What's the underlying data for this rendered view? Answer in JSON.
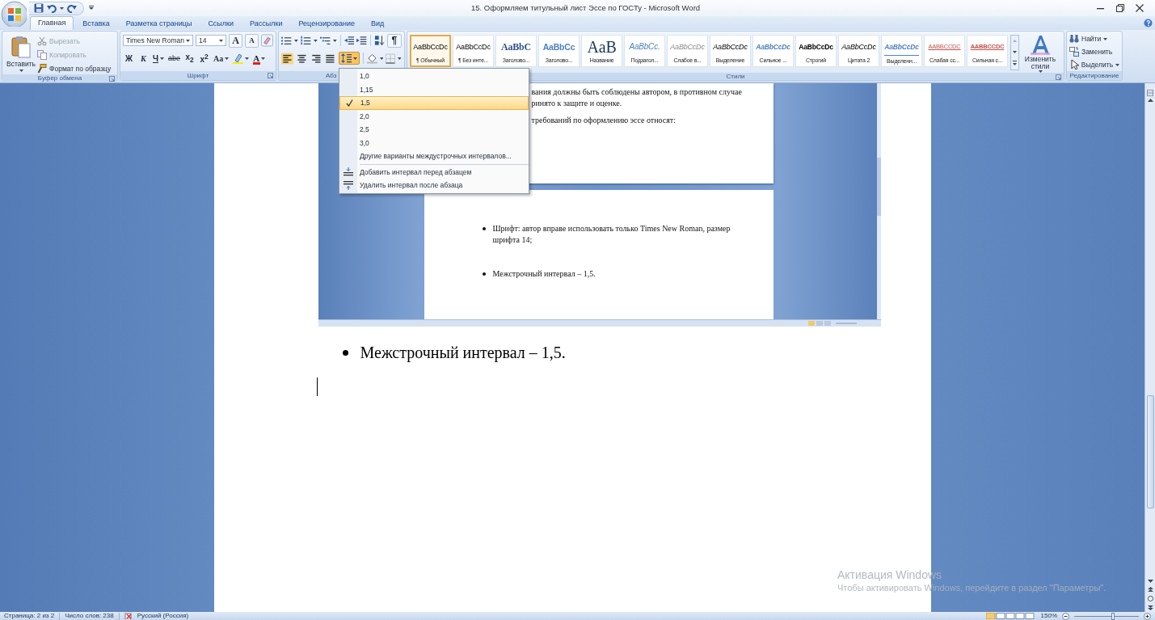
{
  "window": {
    "title": "15. Оформляем титульный лист Эссе по ГОСТу - Microsoft Word"
  },
  "tabs": [
    {
      "label": "Главная",
      "selected": true
    },
    {
      "label": "Вставка",
      "selected": false
    },
    {
      "label": "Разметка страницы",
      "selected": false
    },
    {
      "label": "Ссылки",
      "selected": false
    },
    {
      "label": "Рассылки",
      "selected": false
    },
    {
      "label": "Рецензирование",
      "selected": false
    },
    {
      "label": "Вид",
      "selected": false
    }
  ],
  "clipboard": {
    "title": "Буфер обмена",
    "dialog_launcher": true,
    "paste": "Вставить",
    "items": [
      {
        "kind": "cut",
        "label": "Вырезать",
        "disabled": true
      },
      {
        "kind": "copy",
        "label": "Копировать",
        "disabled": true
      },
      {
        "kind": "format_painter",
        "label": "Формат по образцу",
        "disabled": false
      }
    ]
  },
  "font": {
    "title": "Шрифт",
    "dialog_launcher": true,
    "font_name": "Times New Roman",
    "font_size": "14",
    "top_buttons": [
      {
        "kind": "grow",
        "label": "A"
      },
      {
        "kind": "shrink",
        "label": "A"
      }
    ],
    "format_buttons": [
      {
        "kind": "bold",
        "label": "Ж"
      },
      {
        "kind": "italic",
        "label": "К"
      },
      {
        "kind": "underline",
        "label": "Ч"
      },
      {
        "kind": "strike",
        "label": "abe"
      },
      {
        "kind": "subscript",
        "label": "x$_{2}$"
      },
      {
        "kind": "superscript",
        "label": "x$^{2}$"
      },
      {
        "kind": "case",
        "label": "Aa"
      },
      {
        "kind": "highlight"
      },
      {
        "kind": "font_color",
        "label": "A"
      }
    ]
  },
  "paragraph": {
    "title": "Абз",
    "marks_button": "¶",
    "align_buttons": [
      {
        "kind": "left",
        "selected": true
      },
      {
        "kind": "center",
        "selected": false
      },
      {
        "kind": "right",
        "selected": false
      },
      {
        "kind": "justify",
        "selected": false
      }
    ],
    "line_spacing_active": true
  },
  "styles": {
    "title": "Стили",
    "dialog_launcher": true,
    "change_styles": "Изменить стили",
    "items": [
      {
        "kind": "normal",
        "preview": "AaBbCcDc",
        "label": "¶ Обычный",
        "selected": true
      },
      {
        "kind": "normal",
        "preview": "AaBbCcDc",
        "label": "¶ Без инте...",
        "selected": false
      },
      {
        "kind": "heading1",
        "preview": "AaBbC",
        "label": "Заголово...",
        "selected": false
      },
      {
        "kind": "heading2",
        "preview": "AaBbCc",
        "label": "Заголово...",
        "selected": false
      },
      {
        "kind": "title",
        "preview": "AaB",
        "label": "Название",
        "selected": false
      },
      {
        "kind": "subtitle",
        "preview": "AaBbCc.",
        "label": "Подзагол...",
        "selected": false
      },
      {
        "kind": "subtle",
        "preview": "AaBbCcDc",
        "label": "Слабое в...",
        "selected": false
      },
      {
        "kind": "emphasis",
        "preview": "AaBbCcDc",
        "label": "Выделение",
        "selected": false
      },
      {
        "kind": "intense",
        "preview": "AaBbCcDc",
        "label": "Сильное ...",
        "selected": false
      },
      {
        "kind": "strong",
        "preview": "AaBbCcDc",
        "label": "Строгий",
        "selected": false
      },
      {
        "kind": "quote",
        "preview": "AaBbCcDc",
        "label": "Цитата 2",
        "selected": false
      },
      {
        "kind": "intense_quote",
        "preview": "AaBbCcDc",
        "label": "Выделенн...",
        "selected": false
      },
      {
        "kind": "subtle_ref",
        "preview": "AABBCCDC",
        "label": "Слабая сс...",
        "selected": false
      },
      {
        "kind": "intense_ref",
        "preview": "AABBCCDC",
        "label": "Сильная с...",
        "selected": false
      }
    ]
  },
  "editing": {
    "title": "Редактирование",
    "items": [
      {
        "kind": "find",
        "label": "Найти"
      },
      {
        "kind": "replace",
        "label": "Заменить"
      },
      {
        "kind": "select",
        "label": "Выделить"
      }
    ]
  },
  "line_spacing_menu": {
    "options": [
      {
        "label": "1,0",
        "checked": false
      },
      {
        "label": "1,15",
        "checked": false
      },
      {
        "label": "1,5",
        "checked": true
      },
      {
        "label": "2,0",
        "checked": false
      },
      {
        "label": "2,5",
        "checked": false
      },
      {
        "label": "3,0",
        "checked": false
      }
    ],
    "more": "Другие варианты междустрочных интервалов...",
    "actions": [
      {
        "kind": "add_before",
        "label": "Добавить интервал перед абзацем"
      },
      {
        "kind": "remove_after",
        "label": "Удалить интервал после абзаца"
      }
    ]
  },
  "document": {
    "embedded_screenshot": {
      "page1_lines": [
        "вания должны быть соблюдены автором, в противном случае",
        "ринято к защите и оценке.",
        "требований по оформлению эссе относят:"
      ],
      "page2_bullets": [
        "Шрифт: автор вправе использовать только Times New Roman, размер шрифта 14;",
        "Межстрочный интервал – 1,5."
      ]
    },
    "bullets": [
      "Межстрочный интервал – 1,5."
    ]
  },
  "activation_notice": {
    "title": "Активация Windows",
    "text": "Чтобы активировать Windows, перейдите в раздел \"Параметры\"."
  },
  "status_bar": {
    "page": "Страница: 2 из 2",
    "words": "Число слов: 238",
    "language": "Русский (Россия)",
    "zoom": "150%",
    "zoom_slider": {
      "level": 0.6
    }
  }
}
